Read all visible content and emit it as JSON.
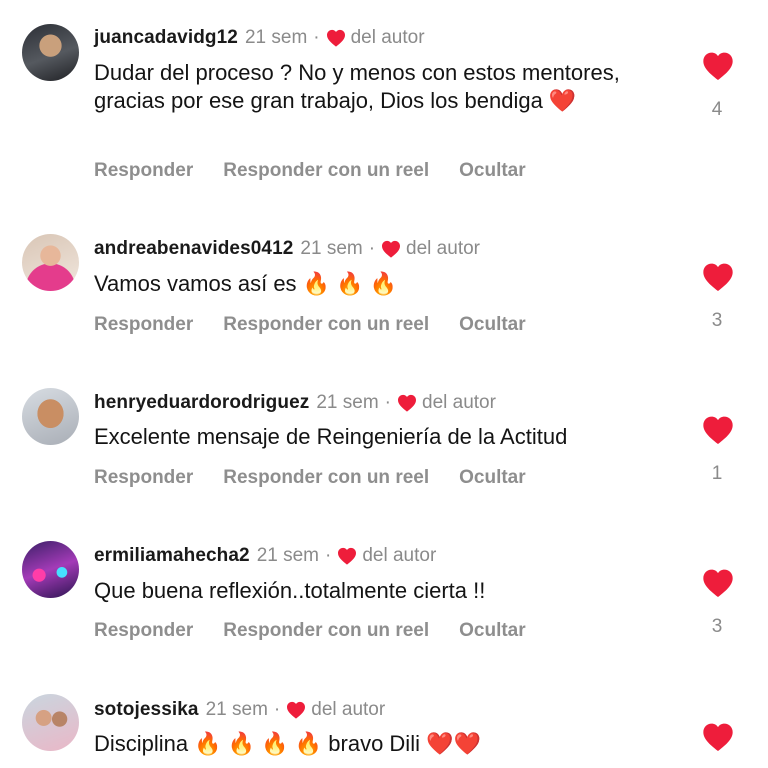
{
  "accent_like": "#ee1d3b",
  "meta_gray": "#8a8a8a",
  "action_labels": {
    "reply": "Responder",
    "reply_reel": "Responder con un reel",
    "hide": "Ocultar"
  },
  "comments": [
    {
      "username": "juancadavidg12",
      "time": "21 sem",
      "author_tag": "del autor",
      "text": "Dudar del proceso ? No y menos con estos mentores, gracias por ese gran trabajo, Dios los bendiga ❤️",
      "likes": "4"
    },
    {
      "username": "andreabenavides0412",
      "time": "21 sem",
      "author_tag": "del autor",
      "text": "Vamos vamos así es 🔥 🔥 🔥",
      "likes": "3"
    },
    {
      "username": "henryeduardorodriguez",
      "time": "21 sem",
      "author_tag": "del autor",
      "text": "Excelente mensaje de Reingeniería de la Actitud",
      "likes": "1"
    },
    {
      "username": "ermiliamahecha2",
      "time": "21 sem",
      "author_tag": "del autor",
      "text": "Que buena reflexión..totalmente cierta !!",
      "likes": "3"
    },
    {
      "username": "sotojessika",
      "time": "21 sem",
      "author_tag": "del autor",
      "text": "Disciplina 🔥 🔥 🔥 🔥  bravo Dili ❤️❤️",
      "likes": ""
    }
  ]
}
